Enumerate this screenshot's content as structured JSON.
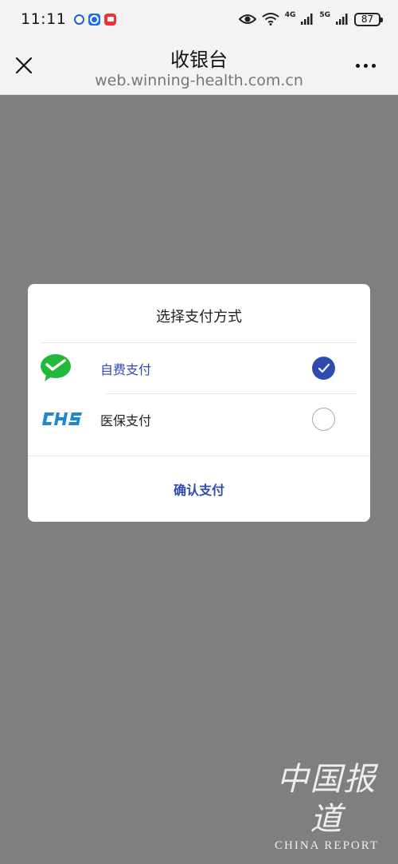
{
  "status_bar": {
    "time": "11:11",
    "signal_4g": "4G",
    "signal_5g": "5G",
    "battery": "87"
  },
  "title_bar": {
    "title": "收银台",
    "url": "web.winning-health.com.cn"
  },
  "dialog": {
    "title": "选择支付方式",
    "options": [
      {
        "label": "自费支付",
        "icon": "wechat-pay-icon",
        "selected": true
      },
      {
        "label": "医保支付",
        "icon": "chs-logo",
        "selected": false
      }
    ],
    "confirm_label": "确认支付"
  },
  "watermark": {
    "chinese": "中国报道",
    "english": "CHINA REPORT"
  },
  "colors": {
    "accent": "#2f4bb0",
    "wechat_green": "#22b93b",
    "chs_blue": "#1e88d3",
    "overlay": "#7f7f7f"
  }
}
